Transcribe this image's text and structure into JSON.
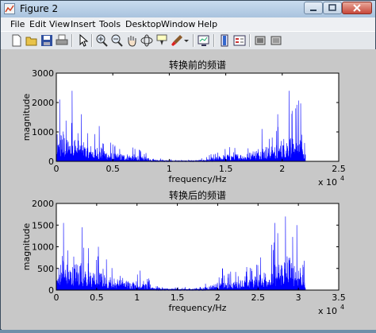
{
  "window": {
    "title": "Figure 2",
    "icon": "matlab-figure-icon"
  },
  "menu": [
    "File",
    "Edit",
    "View",
    "Insert",
    "Tools",
    "Desktop",
    "Window",
    "Help"
  ],
  "toolbar": [
    {
      "icon": "new-figure-icon"
    },
    {
      "icon": "open-file-icon"
    },
    {
      "icon": "save-icon"
    },
    {
      "icon": "print-icon"
    },
    {
      "icon": "edit-plot-arrow-icon"
    },
    {
      "icon": "zoom-in-icon"
    },
    {
      "icon": "zoom-out-icon"
    },
    {
      "icon": "pan-hand-icon"
    },
    {
      "icon": "rotate-3d-icon"
    },
    {
      "icon": "data-cursor-icon"
    },
    {
      "icon": "brush-icon"
    },
    {
      "icon": "link-plot-icon"
    },
    {
      "icon": "insert-colorbar-icon"
    },
    {
      "icon": "insert-legend-icon"
    },
    {
      "icon": "hide-plot-tools-icon"
    },
    {
      "icon": "show-plot-tools-icon"
    }
  ],
  "chart_data": [
    {
      "type": "line",
      "title": "转换前的频谱",
      "xlabel": "frequency/Hz",
      "ylabel": "magnitude",
      "xlim": [
        0,
        25000
      ],
      "ylim": [
        0,
        3000
      ],
      "x_ticks": [
        "0",
        "0.5",
        "1",
        "1.5",
        "2",
        "2.5"
      ],
      "y_ticks": [
        "0",
        "1000",
        "2000",
        "3000"
      ],
      "x_exponent_label": "x 10",
      "x_exponent_power": "4",
      "color": "#0000ff",
      "series_x_max": 22050,
      "envelope": {
        "x": [
          0,
          500,
          1000,
          1500,
          2000,
          2500,
          3000,
          4000,
          5000,
          6000,
          7000,
          8000,
          9000,
          10000,
          11000,
          12000,
          13000,
          14000,
          15000,
          16000,
          17000,
          18000,
          19000,
          19500,
          20000,
          20500,
          21000,
          21500,
          22050
        ],
        "y": [
          700,
          2000,
          1400,
          1650,
          1300,
          1000,
          950,
          850,
          500,
          450,
          420,
          250,
          100,
          60,
          50,
          60,
          100,
          250,
          420,
          450,
          500,
          850,
          950,
          1000,
          1300,
          1650,
          1400,
          2000,
          700
        ]
      },
      "peaks": [
        {
          "x": 300,
          "y": 2100
        },
        {
          "x": 1400,
          "y": 2400
        },
        {
          "x": 2200,
          "y": 1600
        },
        {
          "x": 3800,
          "y": 1200
        },
        {
          "x": 20600,
          "y": 2400
        },
        {
          "x": 19600,
          "y": 1600
        },
        {
          "x": 21200,
          "y": 1800
        },
        {
          "x": 18200,
          "y": 1100
        }
      ]
    },
    {
      "type": "line",
      "title": "转换后的频谱",
      "xlabel": "frequency/Hz",
      "ylabel": "magnitude",
      "xlim": [
        0,
        35000
      ],
      "ylim": [
        0,
        2000
      ],
      "x_ticks": [
        "0",
        "0.5",
        "1",
        "1.5",
        "2",
        "2.5",
        "3",
        "3.5"
      ],
      "y_ticks": [
        "0",
        "500",
        "1000",
        "1500",
        "2000"
      ],
      "x_exponent_label": "x 10",
      "x_exponent_power": "4",
      "color": "#0000ff",
      "series_x_max": 30870,
      "envelope": {
        "x": [
          0,
          700,
          1400,
          2100,
          2800,
          3500,
          4200,
          5600,
          7000,
          8400,
          9800,
          11200,
          12600,
          14000,
          15400,
          16800,
          18200,
          19600,
          21000,
          22400,
          23800,
          25200,
          26600,
          27300,
          28000,
          28700,
          29400,
          30100,
          30870
        ],
        "y": [
          500,
          1500,
          1000,
          1000,
          1250,
          900,
          800,
          700,
          500,
          400,
          350,
          250,
          100,
          70,
          60,
          70,
          100,
          250,
          350,
          400,
          500,
          700,
          900,
          1150,
          1300,
          1500,
          1100,
          1200,
          450
        ]
      },
      "peaks": [
        {
          "x": 900,
          "y": 1550
        },
        {
          "x": 3200,
          "y": 1450
        },
        {
          "x": 5200,
          "y": 1000
        },
        {
          "x": 10400,
          "y": 450
        },
        {
          "x": 28400,
          "y": 1700
        },
        {
          "x": 27100,
          "y": 1550
        },
        {
          "x": 29800,
          "y": 1500
        },
        {
          "x": 20600,
          "y": 500
        }
      ]
    }
  ]
}
